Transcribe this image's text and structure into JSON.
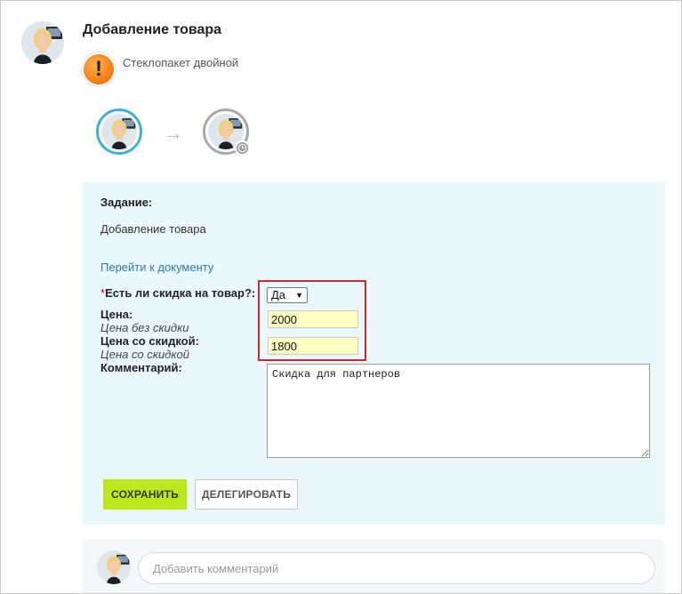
{
  "header": {
    "title": "Добавление товара",
    "subtitle": "Стеклопакет двойной",
    "alert_symbol": "!"
  },
  "workflow": {
    "arrow": "→",
    "steps": [
      {
        "state": "active",
        "border_color": "#3bb3d6"
      },
      {
        "state": "pending",
        "border_color": "#a9a9a9",
        "badge": "clock-icon"
      }
    ]
  },
  "task": {
    "label": "Задание:",
    "text": "Добавление товара",
    "doc_link": "Перейти к документу",
    "background_color": "#eaf8fc"
  },
  "form": {
    "discount": {
      "required_mark": "*",
      "label": "Есть ли скидка на товар?:",
      "selected": "Да",
      "caret": "▼"
    },
    "price": {
      "label": "Цена:",
      "hint": "Цена без скидки",
      "value": "2000"
    },
    "discount_price": {
      "label": "Цена со скидкой:",
      "hint": "Цена со скидкой",
      "value": "1800"
    },
    "comment": {
      "label": "Комментарий:",
      "value": "Скидка для партнеров"
    },
    "highlight_color": "#d1262f",
    "input_bg_color": "#ffffc4"
  },
  "actions": {
    "save_label": "Сохранить",
    "delegate_label": "Делегировать",
    "save_color": "#bce81c"
  },
  "comments": {
    "placeholder": "Добавить комментарий"
  }
}
